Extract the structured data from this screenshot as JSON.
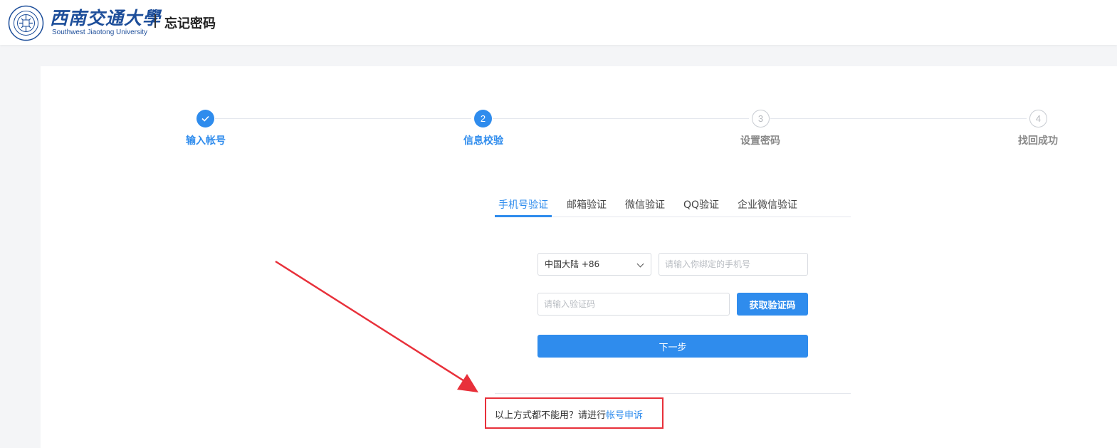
{
  "header": {
    "logo_cn": "西南交通大學",
    "logo_en": "Southwest Jiaotong University",
    "title": "忘记密码"
  },
  "steps": [
    {
      "label": "输入帐号",
      "number": "",
      "state": "done"
    },
    {
      "label": "信息校验",
      "number": "2",
      "state": "active"
    },
    {
      "label": "设置密码",
      "number": "3",
      "state": "pending"
    },
    {
      "label": "找回成功",
      "number": "4",
      "state": "pending"
    }
  ],
  "tabs": [
    {
      "label": "手机号验证",
      "active": true
    },
    {
      "label": "邮箱验证",
      "active": false
    },
    {
      "label": "微信验证",
      "active": false
    },
    {
      "label": "QQ验证",
      "active": false
    },
    {
      "label": "企业微信验证",
      "active": false
    }
  ],
  "form": {
    "country_code": "中国大陆 +86",
    "phone_placeholder": "请输入你绑定的手机号",
    "code_placeholder": "请输入验证码",
    "get_code_label": "获取验证码",
    "next_label": "下一步"
  },
  "footer": {
    "prompt": "以上方式都不能用？请进行",
    "appeal_link": "帐号申诉"
  },
  "colors": {
    "accent": "#2f8ced",
    "highlight": "#e8303a"
  }
}
